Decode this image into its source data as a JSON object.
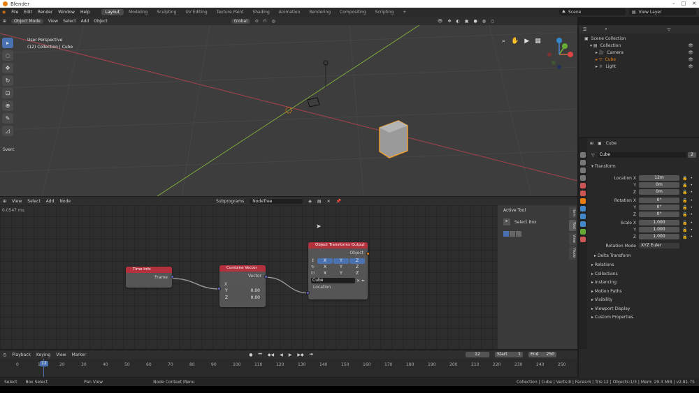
{
  "window": {
    "title": "Blender",
    "controls": [
      "–",
      "□",
      "✕"
    ]
  },
  "menu": [
    "File",
    "Edit",
    "Render",
    "Window",
    "Help"
  ],
  "workspace_tabs": [
    "Layout",
    "Modeling",
    "Sculpting",
    "UV Editing",
    "Texture Paint",
    "Shading",
    "Animation",
    "Rendering",
    "Compositing",
    "Scripting"
  ],
  "workspace_add": "+",
  "active_tab": "Layout",
  "scene": "Scene",
  "view_layer": "View Layer",
  "viewport": {
    "mode": "Object Mode",
    "menus": [
      "View",
      "Select",
      "Add",
      "Object"
    ],
    "transform": "Global",
    "overlay_title": "User Perspective",
    "overlay_sub": "(12) Collection | Cube",
    "sverc_tab": "Sverc"
  },
  "outliner": {
    "title": "Scene Collection",
    "rows": [
      {
        "label": "Collection"
      },
      {
        "label": "Camera"
      },
      {
        "label": "Cube"
      },
      {
        "label": "Light"
      }
    ]
  },
  "properties": {
    "object": "Cube",
    "mesh_name": "Cube",
    "users": "2",
    "transform": "Transform",
    "rows": [
      {
        "label": "Location X",
        "value": "12m"
      },
      {
        "label": "Y",
        "value": "0m"
      },
      {
        "label": "Z",
        "value": "0m"
      },
      {
        "label": "Rotation X",
        "value": "0°"
      },
      {
        "label": "Y",
        "value": "0°"
      },
      {
        "label": "Z",
        "value": "0°"
      },
      {
        "label": "Scale X",
        "value": "1.000"
      },
      {
        "label": "Y",
        "value": "1.000"
      },
      {
        "label": "Z",
        "value": "1.000"
      }
    ],
    "rotation_mode_label": "Rotation Mode",
    "rotation_mode": "XYZ Euler",
    "delta": "Delta Transform",
    "sections": [
      "Relations",
      "Collections",
      "Instancing",
      "Motion Paths",
      "Visibility",
      "Viewport Display",
      "Custom Properties"
    ]
  },
  "node_editor": {
    "menus": [
      "View",
      "Select",
      "Add",
      "Node"
    ],
    "subprograms": "Subprograms",
    "tree": "NodeTree",
    "timing": "0.0547 ms",
    "active_tool_title": "Active Tool",
    "active_tool": "Select Box",
    "side_tabs": [
      "Item",
      "Tool",
      "View",
      "Node"
    ],
    "nodes": {
      "time_info": {
        "title": "Time Info",
        "out": "Frame"
      },
      "combine": {
        "title": "Combine Vector",
        "out": "Vector",
        "x": "X",
        "y_label": "Y",
        "y": "0.00",
        "z_label": "Z",
        "z": "0.00"
      },
      "output": {
        "title": "Object Transforms Output",
        "obj": "Object",
        "axes": [
          "X",
          "Y",
          "Z"
        ],
        "object_field": "Cube",
        "loc": "Location"
      }
    }
  },
  "timeline": {
    "menus": [
      "Playback",
      "Keying",
      "View",
      "Marker"
    ],
    "current": "12",
    "start_label": "Start",
    "start": "1",
    "end_label": "End",
    "end": "250",
    "ticks": [
      "0",
      "10",
      "20",
      "30",
      "40",
      "50",
      "60",
      "70",
      "80",
      "90",
      "100",
      "110",
      "120",
      "130",
      "140",
      "150",
      "160",
      "170",
      "180",
      "190",
      "200",
      "210",
      "220",
      "230",
      "240",
      "250"
    ]
  },
  "status": {
    "items": [
      "Select",
      "Box Select",
      "Pan View",
      "Node Context Menu"
    ],
    "info": "Collection | Cube | Verts:8 | Faces:6 | Tris:12 | Objects:1/3 | Mem: 29.3 MiB | v2.81.75"
  },
  "colors": {
    "accent": "#4a72b0",
    "node_header": "#b3313d",
    "orange": "#e87d0d"
  }
}
